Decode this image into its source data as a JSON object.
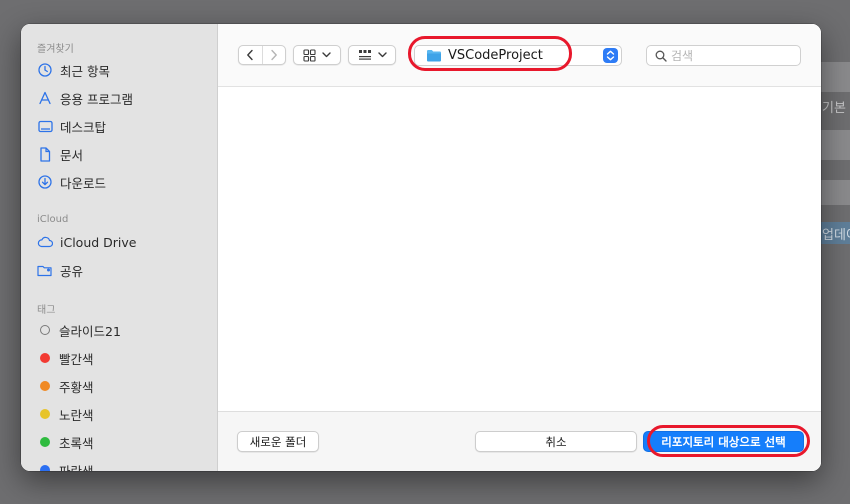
{
  "background_app": {
    "text_basic": "기본 설",
    "text_update": "업데이"
  },
  "sidebar": {
    "favorites_title": "즐겨찾기",
    "favorites": [
      {
        "label": "최근 항목",
        "icon": "clock-icon"
      },
      {
        "label": "응용 프로그램",
        "icon": "applications-icon"
      },
      {
        "label": "데스크탑",
        "icon": "desktop-icon"
      },
      {
        "label": "문서",
        "icon": "document-icon"
      },
      {
        "label": "다운로드",
        "icon": "download-icon"
      }
    ],
    "icloud_title": "iCloud",
    "icloud": [
      {
        "label": "iCloud Drive",
        "icon": "cloud-icon"
      },
      {
        "label": "공유",
        "icon": "shared-folder-icon"
      }
    ],
    "tags_title": "태그",
    "tags": [
      {
        "label": "슬라이드21",
        "color": "hollow"
      },
      {
        "label": "빨간색",
        "color": "#f23a32"
      },
      {
        "label": "주황색",
        "color": "#f08a24"
      },
      {
        "label": "노란색",
        "color": "#e7c42a"
      },
      {
        "label": "초록색",
        "color": "#2fbb3f"
      },
      {
        "label": "파란색",
        "color": "#2b6ff2"
      }
    ]
  },
  "toolbar": {
    "back_icon": "chevron-left-icon",
    "forward_icon": "chevron-right-icon",
    "view_icon": "icon-grid-view-icon",
    "group_icon": "group-by-icon",
    "current_folder": "VSCodeProject",
    "search_placeholder": "검색"
  },
  "footer": {
    "new_folder": "새로운 폴더",
    "cancel": "취소",
    "confirm": "리포지토리 대상으로 선택"
  },
  "colors": {
    "accent": "#157efb",
    "highlight_ring": "#e8182c"
  }
}
